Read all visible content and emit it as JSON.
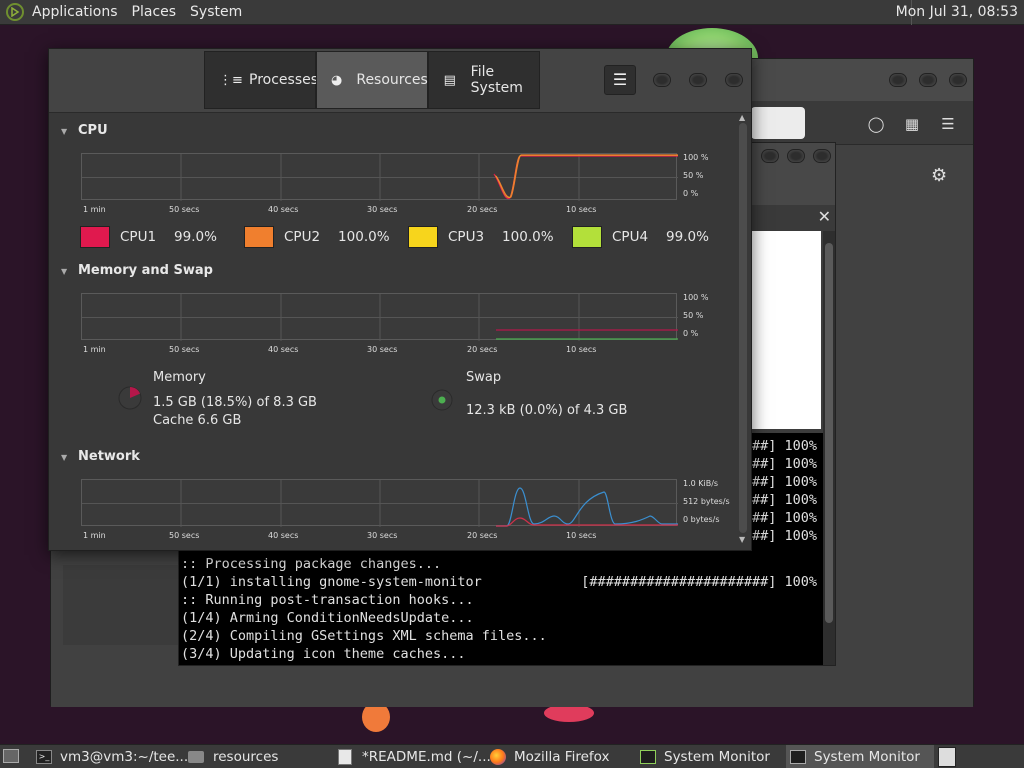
{
  "top_panel": {
    "menus": [
      "Applications",
      "Places",
      "System"
    ],
    "clock": "Mon Jul 31, 08:53"
  },
  "terminal": {
    "lines": [
      {
        "text": "###] 100%"
      },
      {
        "text": "###] 100%"
      },
      {
        "text": "###] 100%"
      },
      {
        "text": "###] 100%"
      },
      {
        "text": "###] 100%"
      },
      {
        "text": "###] 100%"
      }
    ],
    "log": [
      ":: Processing package changes...",
      "(1/1) installing gnome-system-monitor",
      ":: Running post-transaction hooks...",
      "(1/4) Arming ConditionNeedsUpdate...",
      "(2/4) Compiling GSettings XML schema files...",
      "(3/4) Updating icon theme caches..."
    ],
    "progress_bar": "[######################] 100%"
  },
  "system_monitor": {
    "tabs": [
      {
        "label": "Processes",
        "icon": "list-icon"
      },
      {
        "label": "Resources",
        "icon": "gauge-icon"
      },
      {
        "label": "File System",
        "icon": "disk-icon"
      }
    ],
    "active_tab": "Resources",
    "sections": {
      "cpu": "CPU",
      "memory": "Memory and Swap",
      "network": "Network"
    },
    "x_axis": [
      "1 min",
      "50 secs",
      "40 secs",
      "30 secs",
      "20 secs",
      "10 secs"
    ],
    "y_axis_pct": [
      "100 %",
      "50 %",
      "0 %"
    ],
    "y_axis_net": [
      "1.0 KiB/s",
      "512 bytes/s",
      "0 bytes/s"
    ],
    "cpus": [
      {
        "name": "CPU1",
        "value": "99.0%",
        "color": "#e0194e"
      },
      {
        "name": "CPU2",
        "value": "100.0%",
        "color": "#f07f2e"
      },
      {
        "name": "CPU3",
        "value": "100.0%",
        "color": "#f7d51c"
      },
      {
        "name": "CPU4",
        "value": "99.0%",
        "color": "#b3e03a"
      }
    ],
    "memory": {
      "title": "Memory",
      "usage": "1.5 GB (18.5%) of 8.3 GB",
      "cache": "Cache 6.6 GB",
      "used_fraction": 0.185,
      "color": "#b5174a"
    },
    "swap": {
      "title": "Swap",
      "usage": "12.3 kB (0.0%) of 4.3 GB",
      "used_fraction": 0.0,
      "color": "#4caf50"
    }
  },
  "taskbar": {
    "items": [
      {
        "label": "vm3@vm3:~/tee...",
        "icon": "terminal-icon"
      },
      {
        "label": "resources",
        "icon": "folder-icon"
      },
      {
        "label": "*README.md (~/...",
        "icon": "text-editor-icon"
      },
      {
        "label": "Mozilla Firefox",
        "icon": "firefox-icon"
      },
      {
        "label": "System Monitor",
        "icon": "system-monitor-icon"
      },
      {
        "label": "System Monitor",
        "icon": "system-monitor-icon"
      }
    ]
  }
}
